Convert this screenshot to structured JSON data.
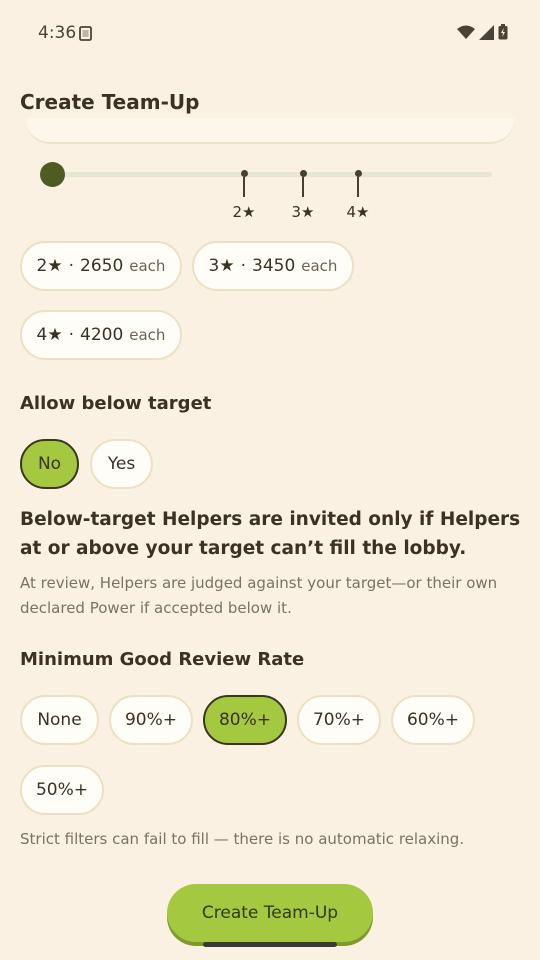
{
  "status_bar": {
    "time": "4:36",
    "notification_icon": "clipboard-icon",
    "icons": [
      "wifi-icon",
      "signal-icon",
      "battery-icon"
    ]
  },
  "header": {
    "title": "Create Team-Up"
  },
  "star_slider": {
    "ticks": [
      {
        "label": "2★"
      },
      {
        "label": "3★"
      },
      {
        "label": "4★"
      }
    ]
  },
  "star_options": [
    {
      "stars": "2★",
      "separator": "·",
      "amount": "2650",
      "each_label": "each"
    },
    {
      "stars": "3★",
      "separator": "·",
      "amount": "3450",
      "each_label": "each"
    },
    {
      "stars": "4★",
      "separator": "·",
      "amount": "4200",
      "each_label": "each"
    }
  ],
  "allow_below_target": {
    "heading": "Allow below target",
    "options": [
      {
        "label": "No",
        "selected": true
      },
      {
        "label": "Yes",
        "selected": false
      }
    ],
    "bold_note": "Below-target Helpers are invited only if Helpers at or above your target can’t fill the lobby.",
    "muted_note": "At review, Helpers are judged against your target—or their own declared Power if accepted below it."
  },
  "review_rate": {
    "heading": "Minimum Good Review Rate",
    "options": [
      {
        "label": "None",
        "selected": false
      },
      {
        "label": "90%+",
        "selected": false
      },
      {
        "label": "80%+",
        "selected": true
      },
      {
        "label": "70%+",
        "selected": false
      },
      {
        "label": "60%+",
        "selected": false
      },
      {
        "label": "50%+",
        "selected": false
      }
    ],
    "note": "Strict filters can fail to fill — there is no automatic relaxing."
  },
  "footer": {
    "create_label": "Create Team-Up"
  },
  "colors": {
    "background": "#fbf1e2",
    "accent": "#a4c83f",
    "slider_thumb": "#4e5b22",
    "text": "#3a3222",
    "muted_text": "#7a7262"
  }
}
